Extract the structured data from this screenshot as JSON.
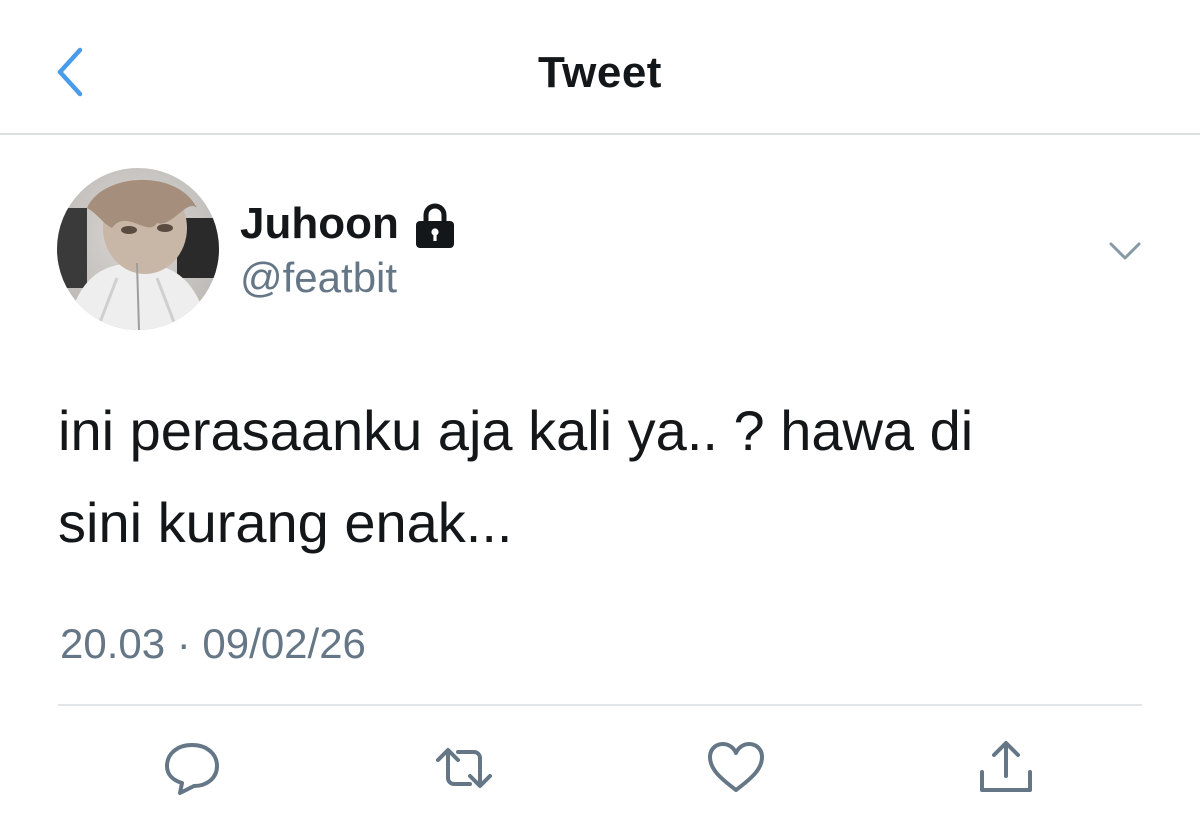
{
  "header": {
    "title": "Tweet",
    "back_icon": "chevron-left-icon",
    "accent_color": "#4a9be9"
  },
  "tweet": {
    "author": {
      "display_name": "Juhoon",
      "handle": "@featbit",
      "protected_icon": "lock-icon"
    },
    "text": "ini perasaanku aja kali ya.. ? hawa di\nsini kurang enak...",
    "timestamp": "20.03 · 09/02/26",
    "menu_icon": "chevron-down-icon"
  },
  "actions": [
    {
      "name": "reply",
      "icon": "reply-icon"
    },
    {
      "name": "retweet",
      "icon": "retweet-icon"
    },
    {
      "name": "like",
      "icon": "heart-icon"
    },
    {
      "name": "share",
      "icon": "share-icon"
    }
  ],
  "colors": {
    "text": "#14171a",
    "secondary_text": "#657786",
    "icon_gray": "#657786",
    "divider": "#e1e5e9"
  }
}
